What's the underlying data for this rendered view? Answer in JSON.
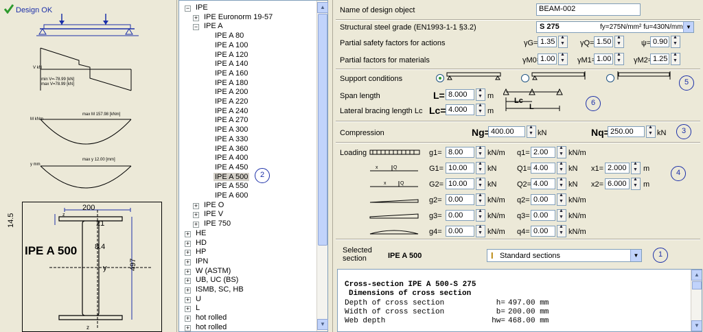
{
  "left": {
    "status": "Design OK",
    "diagram2": {
      "yaxis": "V kN",
      "min": "min V=-78.99 [kN]",
      "max": "max V=78.99 [kN]"
    },
    "diagram3": {
      "yaxis": "M kNm",
      "max": "max M 157.98 [kNm]"
    },
    "diagram4": {
      "yaxis": "y mm",
      "max": "max y 12.00 [mm]"
    },
    "section": {
      "name": "IPE A 500",
      "b": "200",
      "tf": "14.5",
      "r": "21",
      "tw": "8.4",
      "h": "497",
      "yaxis": "y",
      "zaxis": "z"
    }
  },
  "tree": {
    "items": [
      {
        "label": "IPE",
        "level": 0,
        "expander": "-"
      },
      {
        "label": "IPE  Euronorm 19-57",
        "level": 1,
        "expander": "+"
      },
      {
        "label": "IPE A",
        "level": 1,
        "expander": "-"
      },
      {
        "label": "IPE A  80",
        "level": 2
      },
      {
        "label": "IPE A 100",
        "level": 2
      },
      {
        "label": "IPE A 120",
        "level": 2
      },
      {
        "label": "IPE A 140",
        "level": 2
      },
      {
        "label": "IPE A 160",
        "level": 2
      },
      {
        "label": "IPE A 180",
        "level": 2
      },
      {
        "label": "IPE A 200",
        "level": 2
      },
      {
        "label": "IPE A 220",
        "level": 2
      },
      {
        "label": "IPE A 240",
        "level": 2
      },
      {
        "label": "IPE A 270",
        "level": 2
      },
      {
        "label": "IPE A 300",
        "level": 2
      },
      {
        "label": "IPE A 330",
        "level": 2
      },
      {
        "label": "IPE A 360",
        "level": 2
      },
      {
        "label": "IPE A 400",
        "level": 2
      },
      {
        "label": "IPE A 450",
        "level": 2
      },
      {
        "label": "IPE A 500",
        "level": 2,
        "selected": true
      },
      {
        "label": "IPE A 550",
        "level": 2
      },
      {
        "label": "IPE A 600",
        "level": 2
      },
      {
        "label": "IPE O",
        "level": 1,
        "expander": "+"
      },
      {
        "label": "IPE V",
        "level": 1,
        "expander": "+"
      },
      {
        "label": "IPE 750",
        "level": 1,
        "expander": "+"
      },
      {
        "label": "HE",
        "level": 0,
        "expander": "+"
      },
      {
        "label": "HD",
        "level": 0,
        "expander": "+"
      },
      {
        "label": "HP",
        "level": 0,
        "expander": "+"
      },
      {
        "label": "IPN",
        "level": 0,
        "expander": "+"
      },
      {
        "label": "W (ASTM)",
        "level": 0,
        "expander": "+"
      },
      {
        "label": "UB, UC (BS)",
        "level": 0,
        "expander": "+"
      },
      {
        "label": "ISMB, SC, HB",
        "level": 0,
        "expander": "+"
      },
      {
        "label": "U",
        "level": 0,
        "expander": "+"
      },
      {
        "label": "L",
        "level": 0,
        "expander": "+"
      },
      {
        "label": "hot rolled",
        "level": 0,
        "expander": "+"
      },
      {
        "label": "hot rolled",
        "level": 0,
        "expander": "+"
      }
    ],
    "marker": "2"
  },
  "form": {
    "name_label": "Name of design object",
    "name_value": "BEAM-002",
    "grade_label": "Structural steel grade (EN1993-1-1 §3.2)",
    "grade_value": "S 275",
    "grade_props": "fy=275N/mm² fu=430N/mm²",
    "psf_label": "Partial safety factors for actions",
    "gG": "γG=",
    "gG_v": "1.35",
    "gQ": "γQ=",
    "gQ_v": "1.50",
    "psi": "ψ=",
    "psi_v": "0.90",
    "pfm_label": "Partial factors for materials",
    "gM0": "γM0=",
    "gM0_v": "1.00",
    "gM1": "γM1=",
    "gM1_v": "1.00",
    "gM2": "γM2=",
    "gM2_v": "1.25",
    "support_label": "Support conditions",
    "support_marker": "5",
    "span_label": "Span length",
    "L": "L=",
    "L_v": "8.000",
    "L_u": "m",
    "lat_label": "Lateral bracing length Lc",
    "Lc": "Lc=",
    "Lc_v": "4.000",
    "Lc_u": "m",
    "diagram_Lc": "Lc",
    "diagram_L": "L",
    "span_marker": "6",
    "comp_label": "Compression",
    "Ng": "Ng=",
    "Ng_v": "400.00",
    "Ng_u": "kN",
    "Nq": "Nq=",
    "Nq_v": "250.00",
    "Nq_u": "kN",
    "comp_marker": "3",
    "loading_label": "Loading",
    "loading_marker": "4",
    "g1": "g1=",
    "g1_v": "8.00",
    "g1_u": "kN/m",
    "q1": "q1=",
    "q1_v": "2.00",
    "q1_u": "kN/m",
    "G1": "G1=",
    "G1_v": "10.00",
    "G1_u": "kN",
    "Q1": "Q1=",
    "Q1_v": "4.00",
    "Q1_u": "kN",
    "x1": "x1=",
    "x1_v": "2.000",
    "x1_u": "m",
    "G2": "G2=",
    "G2_v": "10.00",
    "G2_u": "kN",
    "Q2": "Q2=",
    "Q2_v": "4.00",
    "Q2_u": "kN",
    "x2": "x2=",
    "x2_v": "6.000",
    "x2_u": "m",
    "g2": "g2=",
    "g2_v": "0.00",
    "g2_u": "kN/m",
    "q2": "q2=",
    "q2_v": "0.00",
    "q2_u": "kN/m",
    "g3": "g3=",
    "g3_v": "0.00",
    "g3_u": "kN/m",
    "q3": "q3=",
    "q3_v": "0.00",
    "q3_u": "kN/m",
    "g4": "g4=",
    "g4_v": "0.00",
    "g4_u": "kN/m",
    "q4": "q4=",
    "q4_v": "0.00",
    "q4_u": "kN/m",
    "sel_label1": "Selected",
    "sel_label2": "section",
    "sel_value": "IPE A 500",
    "sel_combo": "Standard sections",
    "sel_marker": "1"
  },
  "report": {
    "title": "Cross-section  IPE A 500-S 275",
    "subtitle": "Dimensions of cross section",
    "rows": [
      {
        "label": "Depth of cross section",
        "sym": "h=",
        "val": "497.00 mm"
      },
      {
        "label": "Width of cross section",
        "sym": "b=",
        "val": "200.00 mm"
      },
      {
        "label": "Web depth",
        "sym": "hw=",
        "val": "468.00 mm"
      }
    ]
  },
  "colors": {
    "accent": "#1b2fa8",
    "check": "#2e9a2e"
  }
}
